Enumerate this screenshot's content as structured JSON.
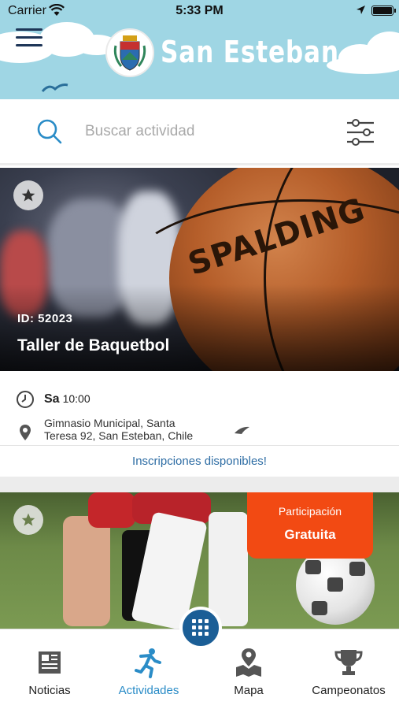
{
  "status_bar": {
    "carrier": "Carrier",
    "time": "5:33 PM"
  },
  "header": {
    "title": "San Esteban"
  },
  "search": {
    "placeholder": "Buscar actividad"
  },
  "activities": [
    {
      "id_label": "ID: 52023",
      "title": "Taller de Baquetbol",
      "day": "Sa",
      "time": "10:00",
      "address": "Gimnasio Municipal,  Santa Teresa 92, San Esteban, Chile",
      "signup_text": "Inscripciones disponibles!",
      "image_brand": "SPALDING"
    },
    {
      "badge_line1": "Participación",
      "badge_line2": "Gratuita"
    }
  ],
  "tabs": [
    {
      "label": "Noticias",
      "icon": "newspaper-icon"
    },
    {
      "label": "Actividades",
      "icon": "runner-icon",
      "active": true
    },
    {
      "label": "Mapa",
      "icon": "map-pin-icon"
    },
    {
      "label": "Campeonatos",
      "icon": "trophy-icon"
    }
  ],
  "colors": {
    "header_bg": "#9fd6e4",
    "accent": "#2a8cc7",
    "fab": "#1b5e96",
    "badge": "#f24a13",
    "link": "#2e6da4"
  }
}
